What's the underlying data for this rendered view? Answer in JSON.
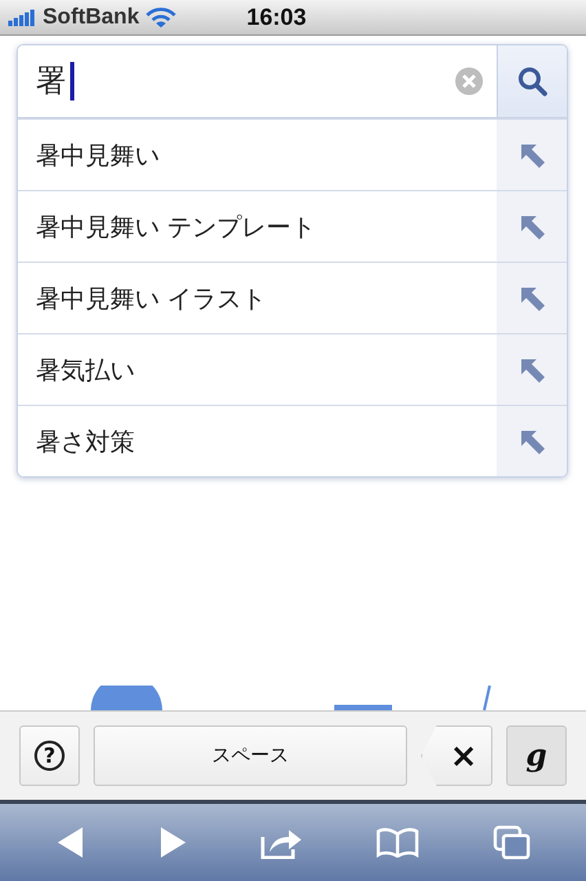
{
  "status_bar": {
    "carrier": "SoftBank",
    "time": "16:03"
  },
  "search": {
    "value": "署"
  },
  "suggestions": [
    {
      "text": "暑中見舞い"
    },
    {
      "text": "暑中見舞い テンプレート"
    },
    {
      "text": "暑中見舞い イラスト"
    },
    {
      "text": "暑気払い"
    },
    {
      "text": "暑さ対策"
    }
  ],
  "keyboard_bar": {
    "space_label": "スペース",
    "delete_label": "×",
    "handwriting_label": "g",
    "help_label": "?"
  }
}
